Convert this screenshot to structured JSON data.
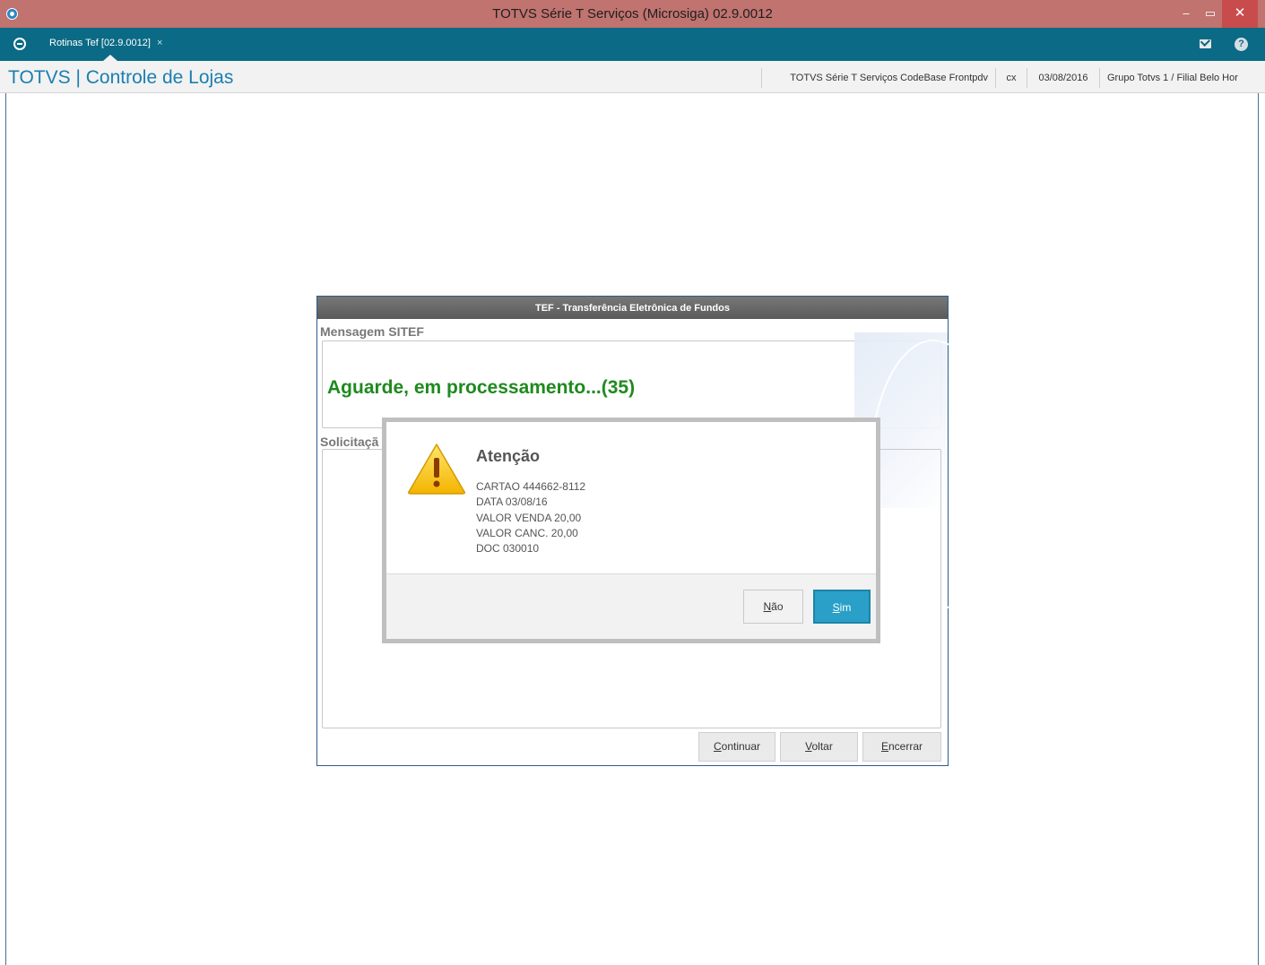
{
  "window": {
    "title": "TOTVS Série T Serviços (Microsiga) 02.9.0012",
    "minimize": "–",
    "maximize": "▭",
    "close": "✕"
  },
  "tabs": [
    {
      "label": "Rotinas Tef [02.9.0012]",
      "close": "×"
    }
  ],
  "header": {
    "app_title": "TOTVS | Controle de Lojas",
    "environment": "TOTVS Série T Serviços CodeBase Frontpdv",
    "user": "cx",
    "date": "03/08/2016",
    "branch": "Grupo Totvs 1 / Filial Belo Hor"
  },
  "tef": {
    "title": "TEF - Transferência Eletrônica de Fundos",
    "message_label": "Mensagem SITEF",
    "message": "Aguarde, em processamento...(35)",
    "request_label": "Solicitaçã",
    "buttons": {
      "continue_accel": "C",
      "continue_rest": "ontinuar",
      "back_accel": "V",
      "back_rest": "oltar",
      "finish_accel": "E",
      "finish_rest": "ncerrar"
    }
  },
  "dialog": {
    "title": "Atenção",
    "icon": "warning-icon",
    "lines": [
      "CARTAO 444662-8112",
      "DATA 03/08/16",
      "VALOR VENDA 20,00",
      "VALOR CANC. 20,00",
      "DOC 030010"
    ],
    "no_accel": "N",
    "no_rest": "ão",
    "yes_accel": "S",
    "yes_rest": "im"
  },
  "colors": {
    "titlebar": "#c0736f",
    "tabbar": "#0b6a85",
    "accent": "#1a7fb0",
    "message_green": "#1e8a1e",
    "primary_button": "#2aa0c8"
  }
}
